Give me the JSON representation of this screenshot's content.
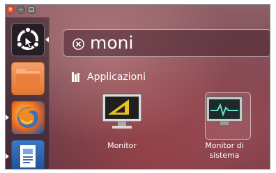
{
  "window_controls": {
    "close_glyph": "×",
    "minimize_glyph": "–",
    "maximize_glyph": "▢"
  },
  "launcher": {
    "items": [
      {
        "name": "dash-home",
        "icon": "ubuntu-logo-icon",
        "active": true
      },
      {
        "name": "files",
        "icon": "folder-icon",
        "active": false
      },
      {
        "name": "firefox",
        "icon": "firefox-icon",
        "active": false
      },
      {
        "name": "writer",
        "icon": "document-icon",
        "active": false
      }
    ]
  },
  "search": {
    "query": "moni",
    "clear_icon": "clear-icon"
  },
  "results": {
    "section_title": "Applicazioni",
    "section_icon": "applications-icon",
    "apps": [
      {
        "label": "Monitor",
        "icon": "monitor-icon"
      },
      {
        "label_line1": "Monitor di",
        "label_line2": "sistema",
        "icon": "system-monitor-icon"
      }
    ]
  },
  "colors": {
    "accent_close": "#e2572d",
    "files_orange": "#e6762e",
    "writer_blue": "#1e4f93"
  }
}
